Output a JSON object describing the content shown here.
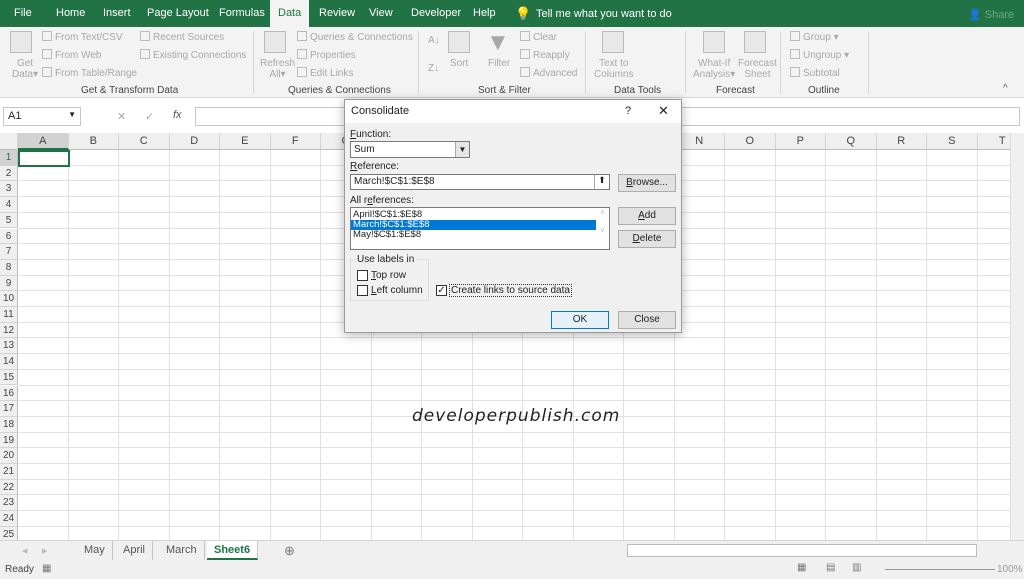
{
  "tabs": [
    "File",
    "Home",
    "Insert",
    "Page Layout",
    "Formulas",
    "Data",
    "Review",
    "View",
    "Developer",
    "Help"
  ],
  "active_tab": "Data",
  "tell_me": "Tell me what you want to do",
  "share": "Share",
  "ribbon": {
    "get_data": [
      "Get",
      "Data"
    ],
    "from_text": "From Text/CSV",
    "from_web": "From Web",
    "from_table": "From Table/Range",
    "recent": "Recent Sources",
    "existing": "Existing Connections",
    "refresh": [
      "Refresh",
      "All"
    ],
    "queries": "Queries & Connections",
    "properties": "Properties",
    "edit_links": "Edit Links",
    "sort": "Sort",
    "filter": "Filter",
    "clear": "Clear",
    "reapply": "Reapply",
    "advanced": "Advanced",
    "text_to_columns": [
      "Text to",
      "Columns"
    ],
    "whatif": [
      "What-If",
      "Analysis"
    ],
    "forecast_sheet": [
      "Forecast",
      "Sheet"
    ],
    "group": "Group",
    "ungroup": "Ungroup",
    "subtotal": "Subtotal",
    "groups": [
      "Get & Transform Data",
      "Queries & Connections",
      "Sort & Filter",
      "Data Tools",
      "Forecast",
      "Outline"
    ]
  },
  "name_box": "A1",
  "fx": "fx",
  "columns": [
    "A",
    "B",
    "C",
    "D",
    "E",
    "F",
    "G",
    "H",
    "I",
    "J",
    "K",
    "L",
    "M",
    "N",
    "O",
    "P",
    "Q",
    "R",
    "S",
    "T"
  ],
  "rows": 25,
  "selected_cell": "A1",
  "watermark": "developerpublish.com",
  "sheets": [
    "May",
    "April",
    "March",
    "Sheet6"
  ],
  "active_sheet": "Sheet6",
  "status": {
    "ready": "Ready",
    "zoom": "100%"
  },
  "dialog": {
    "title": "Consolidate",
    "help": "?",
    "function_label": "Function:",
    "function_value": "Sum",
    "reference_label": "Reference:",
    "reference_value": "March!$C$1:$E$8",
    "browse": "Browse...",
    "all_refs_label": "All references:",
    "all_refs": [
      "April!$C$1:$E$8",
      "March!$C$1:$E$8",
      "May!$C$1:$E$8"
    ],
    "selected_ref": 1,
    "add": "Add",
    "delete": "Delete",
    "use_labels": "Use labels in",
    "top_row": "Top row",
    "left_column": "Left column",
    "top_row_checked": false,
    "left_column_checked": false,
    "create_links": "Create links to source data",
    "create_links_checked": true,
    "ok": "OK",
    "close": "Close"
  },
  "colors": {
    "excel_green": "#217346",
    "selection": "#0078d7"
  }
}
